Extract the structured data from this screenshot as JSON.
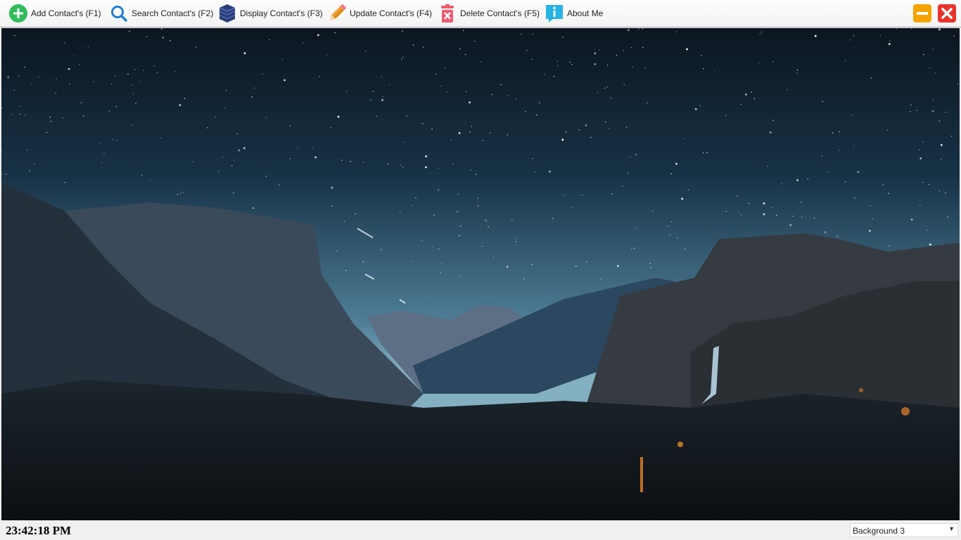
{
  "toolbar": {
    "add_label": "Add Contact's (F1)",
    "search_label": "Search Contact's (F2)",
    "display_label": "Display Contact's (F3)",
    "update_label": "Update Contact's (F4)",
    "delete_label": "Delete Contact's (F5)",
    "about_label": "About Me",
    "icons": [
      "plus-circle-icon",
      "search-icon",
      "database-icon",
      "pencil-icon",
      "trash-icon",
      "info-icon",
      "minimize-icon",
      "close-icon"
    ]
  },
  "colors": {
    "add": "#2ebd59",
    "search": "#1e7fd6",
    "database": "#2a3f7a",
    "pencil": "#f0a030",
    "trash": "#f05a6e",
    "info": "#27b3e6",
    "minimize": "#f5a300",
    "close": "#e8332b"
  },
  "status": {
    "clock": "23:42:18 PM",
    "background_selected": "Background 3"
  }
}
